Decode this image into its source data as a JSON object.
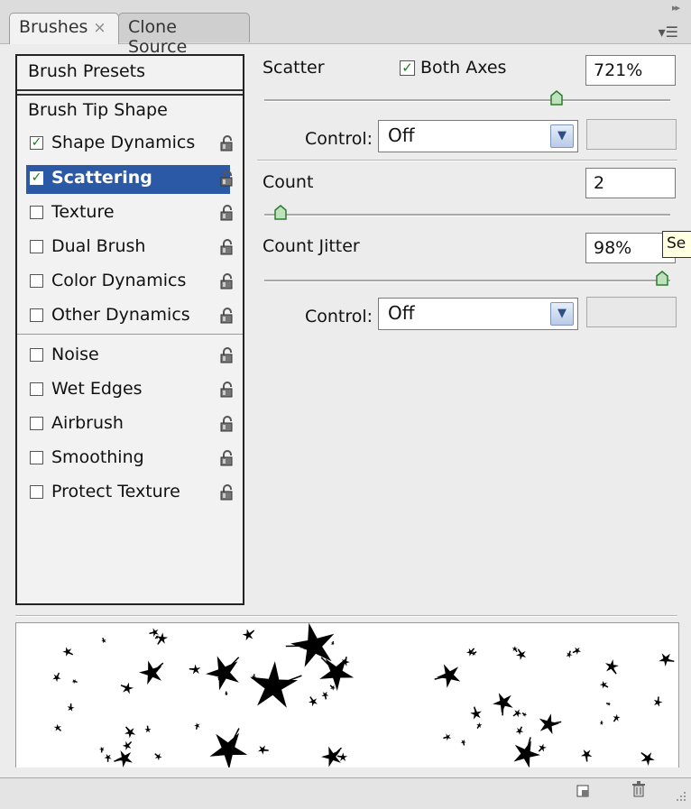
{
  "tabs": [
    {
      "label": "Brushes",
      "close": "×",
      "active": true
    },
    {
      "label": "Clone Source",
      "active": false
    }
  ],
  "window_controls": {
    "collapse": "▸▸",
    "menu": "▾☰"
  },
  "left_panel": {
    "presets_label": "Brush Presets",
    "tip_shape_label": "Brush Tip Shape",
    "items": [
      {
        "label": "Shape Dynamics",
        "checked": true
      },
      {
        "label": "Scattering",
        "checked": true,
        "selected": true
      },
      {
        "label": "Texture",
        "checked": false
      },
      {
        "label": "Dual Brush",
        "checked": false
      },
      {
        "label": "Color Dynamics",
        "checked": false
      },
      {
        "label": "Other Dynamics",
        "checked": false
      },
      {
        "label": "Noise",
        "checked": false
      },
      {
        "label": "Wet Edges",
        "checked": false
      },
      {
        "label": "Airbrush",
        "checked": false
      },
      {
        "label": "Smoothing",
        "checked": false
      },
      {
        "label": "Protect Texture",
        "checked": false
      }
    ]
  },
  "scatter": {
    "label": "Scatter",
    "both_axes_label": "Both Axes",
    "both_axes_checked": true,
    "value": "721%",
    "slider_fraction": 0.72,
    "control_label": "Control:",
    "control_value": "Off"
  },
  "count": {
    "label": "Count",
    "value": "2",
    "slider_fraction": 0.04
  },
  "count_jitter": {
    "label": "Count Jitter",
    "value": "98%",
    "slider_fraction": 0.98,
    "control_label": "Control:",
    "control_value": "Off",
    "tooltip": "Se"
  },
  "colors": {
    "selection": "#2c59a6",
    "checkmark": "#1a7a1a"
  },
  "icons": {
    "lock": "lock-icon",
    "dropdown": "chevron-down-icon",
    "new_brush": "new-brush-icon",
    "trash": "trash-icon",
    "grip": "resize-grip-icon"
  }
}
